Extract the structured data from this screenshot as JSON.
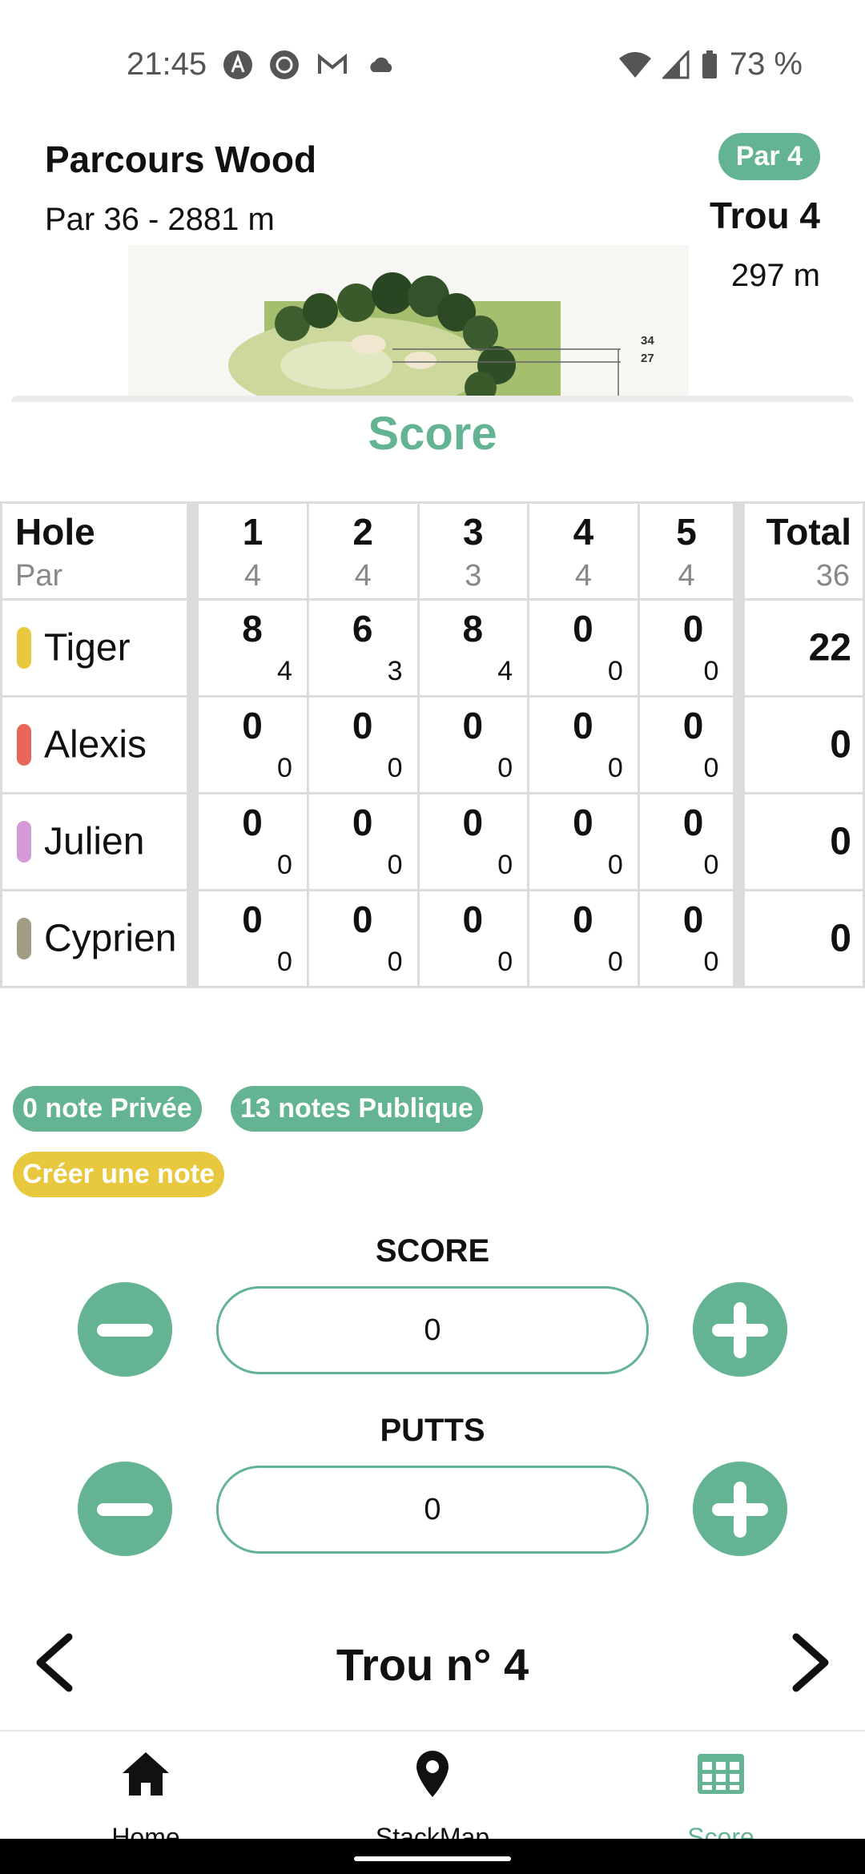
{
  "status_bar": {
    "time": "21:45",
    "battery": "73 %"
  },
  "course": {
    "name": "Parcours Wood",
    "info": "Par 36 - 2881 m"
  },
  "hole": {
    "par_badge": "Par 4",
    "title": "Trou 4",
    "distance": "297 m",
    "map_markers": [
      "34",
      "27"
    ]
  },
  "score_section_title": "Score",
  "scorecard": {
    "header_label": "Hole",
    "par_label": "Par",
    "holes": [
      "1",
      "2",
      "3",
      "4",
      "5"
    ],
    "pars": [
      "4",
      "4",
      "3",
      "4",
      "4"
    ],
    "total_label": "Total",
    "total_par": "36",
    "players": [
      {
        "name": "Tiger",
        "color": "#e8c83e",
        "scores": [
          "8",
          "6",
          "8",
          "0",
          "0"
        ],
        "putts": [
          "4",
          "3",
          "4",
          "0",
          "0"
        ],
        "total": "22"
      },
      {
        "name": "Alexis",
        "color": "#e8675a",
        "scores": [
          "0",
          "0",
          "0",
          "0",
          "0"
        ],
        "putts": [
          "0",
          "0",
          "0",
          "0",
          "0"
        ],
        "total": "0"
      },
      {
        "name": "Julien",
        "color": "#d49ad8",
        "scores": [
          "0",
          "0",
          "0",
          "0",
          "0"
        ],
        "putts": [
          "0",
          "0",
          "0",
          "0",
          "0"
        ],
        "total": "0"
      },
      {
        "name": "Cyprien",
        "color": "#a39c84",
        "scores": [
          "0",
          "0",
          "0",
          "0",
          "0"
        ],
        "putts": [
          "0",
          "0",
          "0",
          "0",
          "0"
        ],
        "total": "0"
      }
    ]
  },
  "notes": {
    "private": "0 note Privée",
    "public": "13 notes Publique",
    "create": "Créer une note"
  },
  "score_input": {
    "label": "SCORE",
    "value": "0"
  },
  "putts_input": {
    "label": "PUTTS",
    "value": "0"
  },
  "hole_nav": {
    "title": "Trou n° 4"
  },
  "bottom_nav": {
    "home": "Home",
    "map": "StackMap",
    "score": "Score"
  },
  "colors": {
    "accent": "#64b393",
    "yellow": "#e8c83e"
  }
}
